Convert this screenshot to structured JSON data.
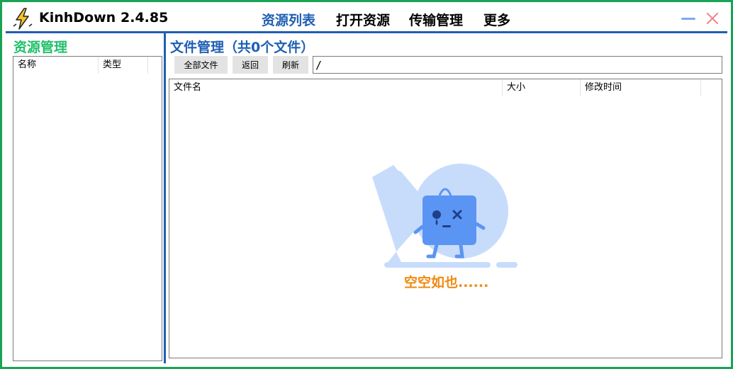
{
  "app": {
    "name": "KinhDown",
    "version": "2.4.85",
    "logo_icon": "lightning-bolt-icon"
  },
  "nav": {
    "items": [
      {
        "label": "资源列表",
        "active": true
      },
      {
        "label": "打开资源",
        "active": false
      },
      {
        "label": "传输管理",
        "active": false
      },
      {
        "label": "更多",
        "active": false
      }
    ]
  },
  "window_controls": {
    "minimize_icon": "minimize-icon",
    "close_icon": "close-icon"
  },
  "resource_panel": {
    "title": "资源管理",
    "columns": [
      "名称",
      "类型"
    ],
    "rows": []
  },
  "file_panel": {
    "title": "文件管理（共0个文件）",
    "buttons": {
      "all_files": "全部文件",
      "back": "返回",
      "refresh": "刷新"
    },
    "path": "/",
    "columns": [
      "文件名",
      "大小",
      "修改时间"
    ],
    "rows": [],
    "empty_text": "空空如也......"
  },
  "colors": {
    "window_border": "#1aa355",
    "accent_blue": "#1f5fb4",
    "left_title_green": "#20c06a",
    "empty_text_orange": "#f08a12",
    "illustration_blue": "#c7dcfb",
    "illustration_dark_blue": "#5b95f3"
  }
}
